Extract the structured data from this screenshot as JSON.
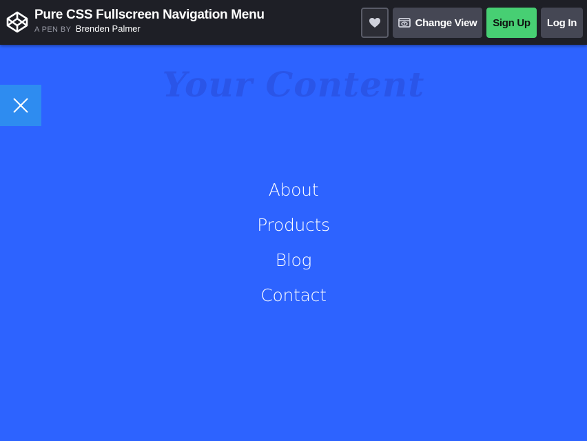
{
  "header": {
    "pen_title": "Pure CSS Fullscreen Navigation Menu",
    "byline_prefix": "A PEN BY",
    "author": "Brenden Palmer",
    "icons": {
      "logo": "codepen-logo-icon",
      "heart": "heart-icon",
      "view": "eye-icon"
    },
    "buttons": {
      "change_view": "Change View",
      "sign_up": "Sign Up",
      "log_in": "Log In"
    },
    "colors": {
      "bar": "#1e1f26",
      "signup": "#47cf73",
      "button": "#454754"
    }
  },
  "content": {
    "background_title": "Your Content",
    "close_icon": "close-icon",
    "nav_items": [
      "About",
      "Products",
      "Blog",
      "Contact"
    ],
    "colors": {
      "background": "#2d63ff",
      "close_button": "#2e8cf0"
    }
  }
}
